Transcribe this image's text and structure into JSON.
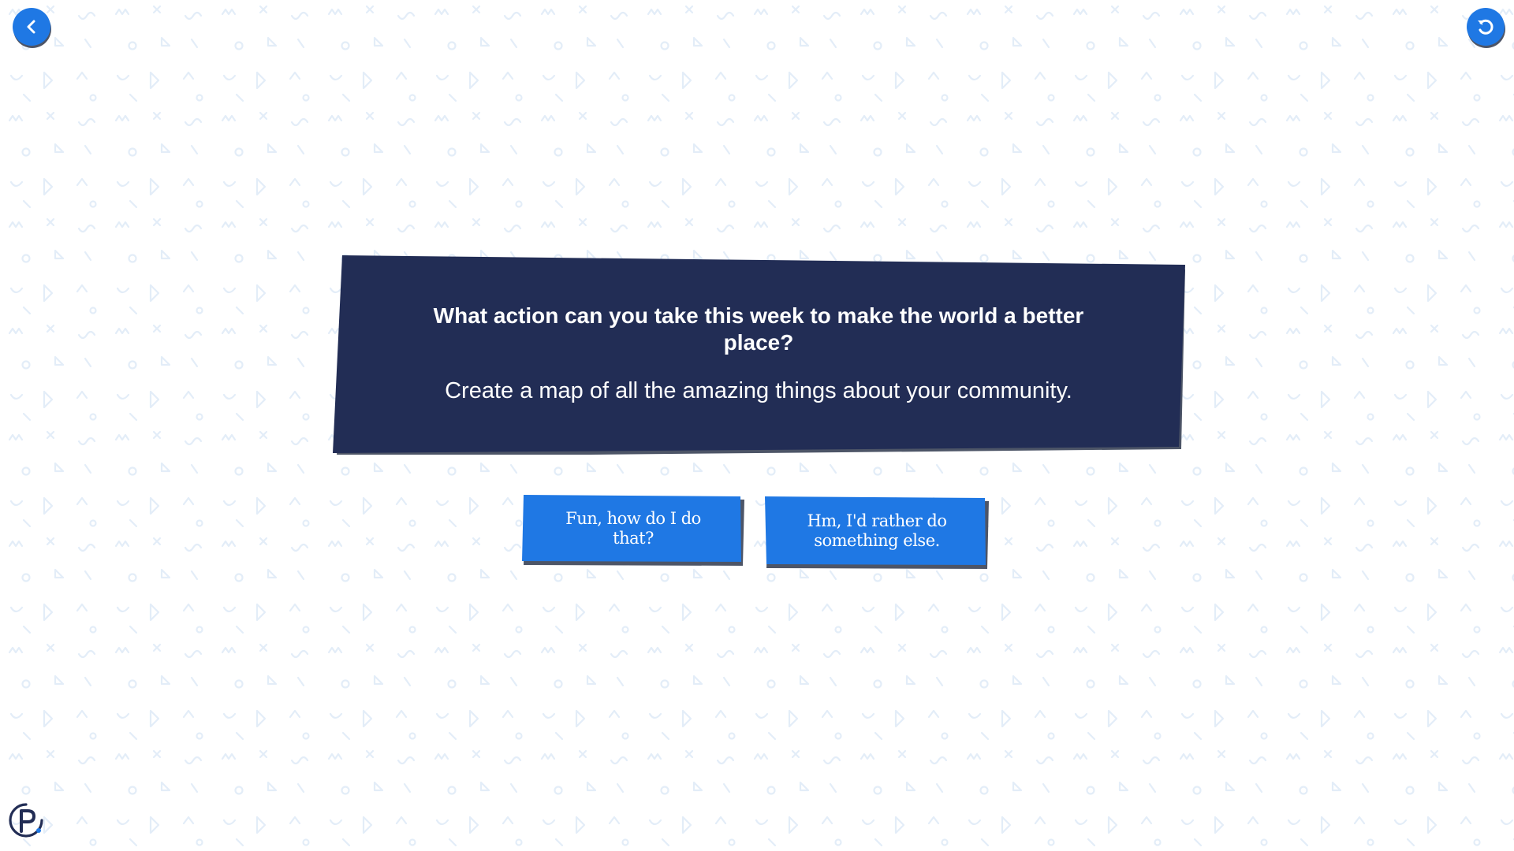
{
  "colors": {
    "accent": "#1f78e4",
    "card": "#222d55",
    "shadow": "#4d5567",
    "pattern": "#e3edf8",
    "logo": "#222d55"
  },
  "nav": {
    "back_icon": "chevron-left-icon",
    "restart_icon": "restart-icon"
  },
  "prompt": {
    "question": "What action can you take this week to make the world a better place?",
    "answer": "Create a map of all the amazing things about your community."
  },
  "choices": [
    {
      "label": "Fun, how do I do that?"
    },
    {
      "label": "Hm, I'd rather do something else."
    }
  ],
  "footer": {
    "logo_icon": "p-logo-icon"
  }
}
